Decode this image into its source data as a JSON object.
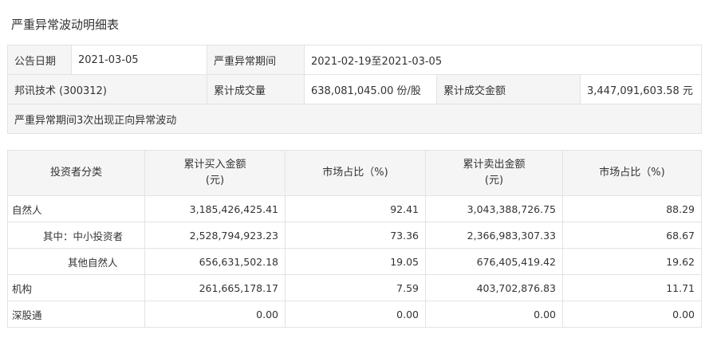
{
  "page": {
    "title": "严重异常波动明细表"
  },
  "summary": {
    "announce_date_label": "公告日期",
    "announce_date": "2021-03-05",
    "period_label": "严重异常期间",
    "period": "2021-02-19至2021-03-05",
    "stock_name": "邦讯技术 (300312)",
    "volume_label": "累计成交量",
    "volume": "638,081,045.00 份/股",
    "amount_label": "累计成交金额",
    "amount": "3,447,091,603.58 元",
    "note": "严重异常期间3次出现正向异常波动"
  },
  "detail": {
    "headers": {
      "category": "投资者分类",
      "buy_amount_line1": "累计买入金额",
      "buy_amount_line2": "(元)",
      "buy_share": "市场占比（%)",
      "sell_amount_line1": "累计卖出金额",
      "sell_amount_line2": "(元)",
      "sell_share": "市场占比（%)"
    },
    "rows": [
      {
        "category": "自然人",
        "buy": "3,185,426,425.41",
        "buy_pct": "92.41",
        "sell": "3,043,388,726.75",
        "sell_pct": "88.29"
      },
      {
        "category": "其中：中小投资者",
        "buy": "2,528,794,923.23",
        "buy_pct": "73.36",
        "sell": "2,366,983,307.33",
        "sell_pct": "68.67"
      },
      {
        "category": "其他自然人",
        "buy": "656,631,502.18",
        "buy_pct": "19.05",
        "sell": "676,405,419.42",
        "sell_pct": "19.62"
      },
      {
        "category": "机构",
        "buy": "261,665,178.17",
        "buy_pct": "7.59",
        "sell": "403,702,876.83",
        "sell_pct": "11.71"
      },
      {
        "category": "深股通",
        "buy": "0.00",
        "buy_pct": "0.00",
        "sell": "0.00",
        "sell_pct": "0.00"
      }
    ]
  }
}
